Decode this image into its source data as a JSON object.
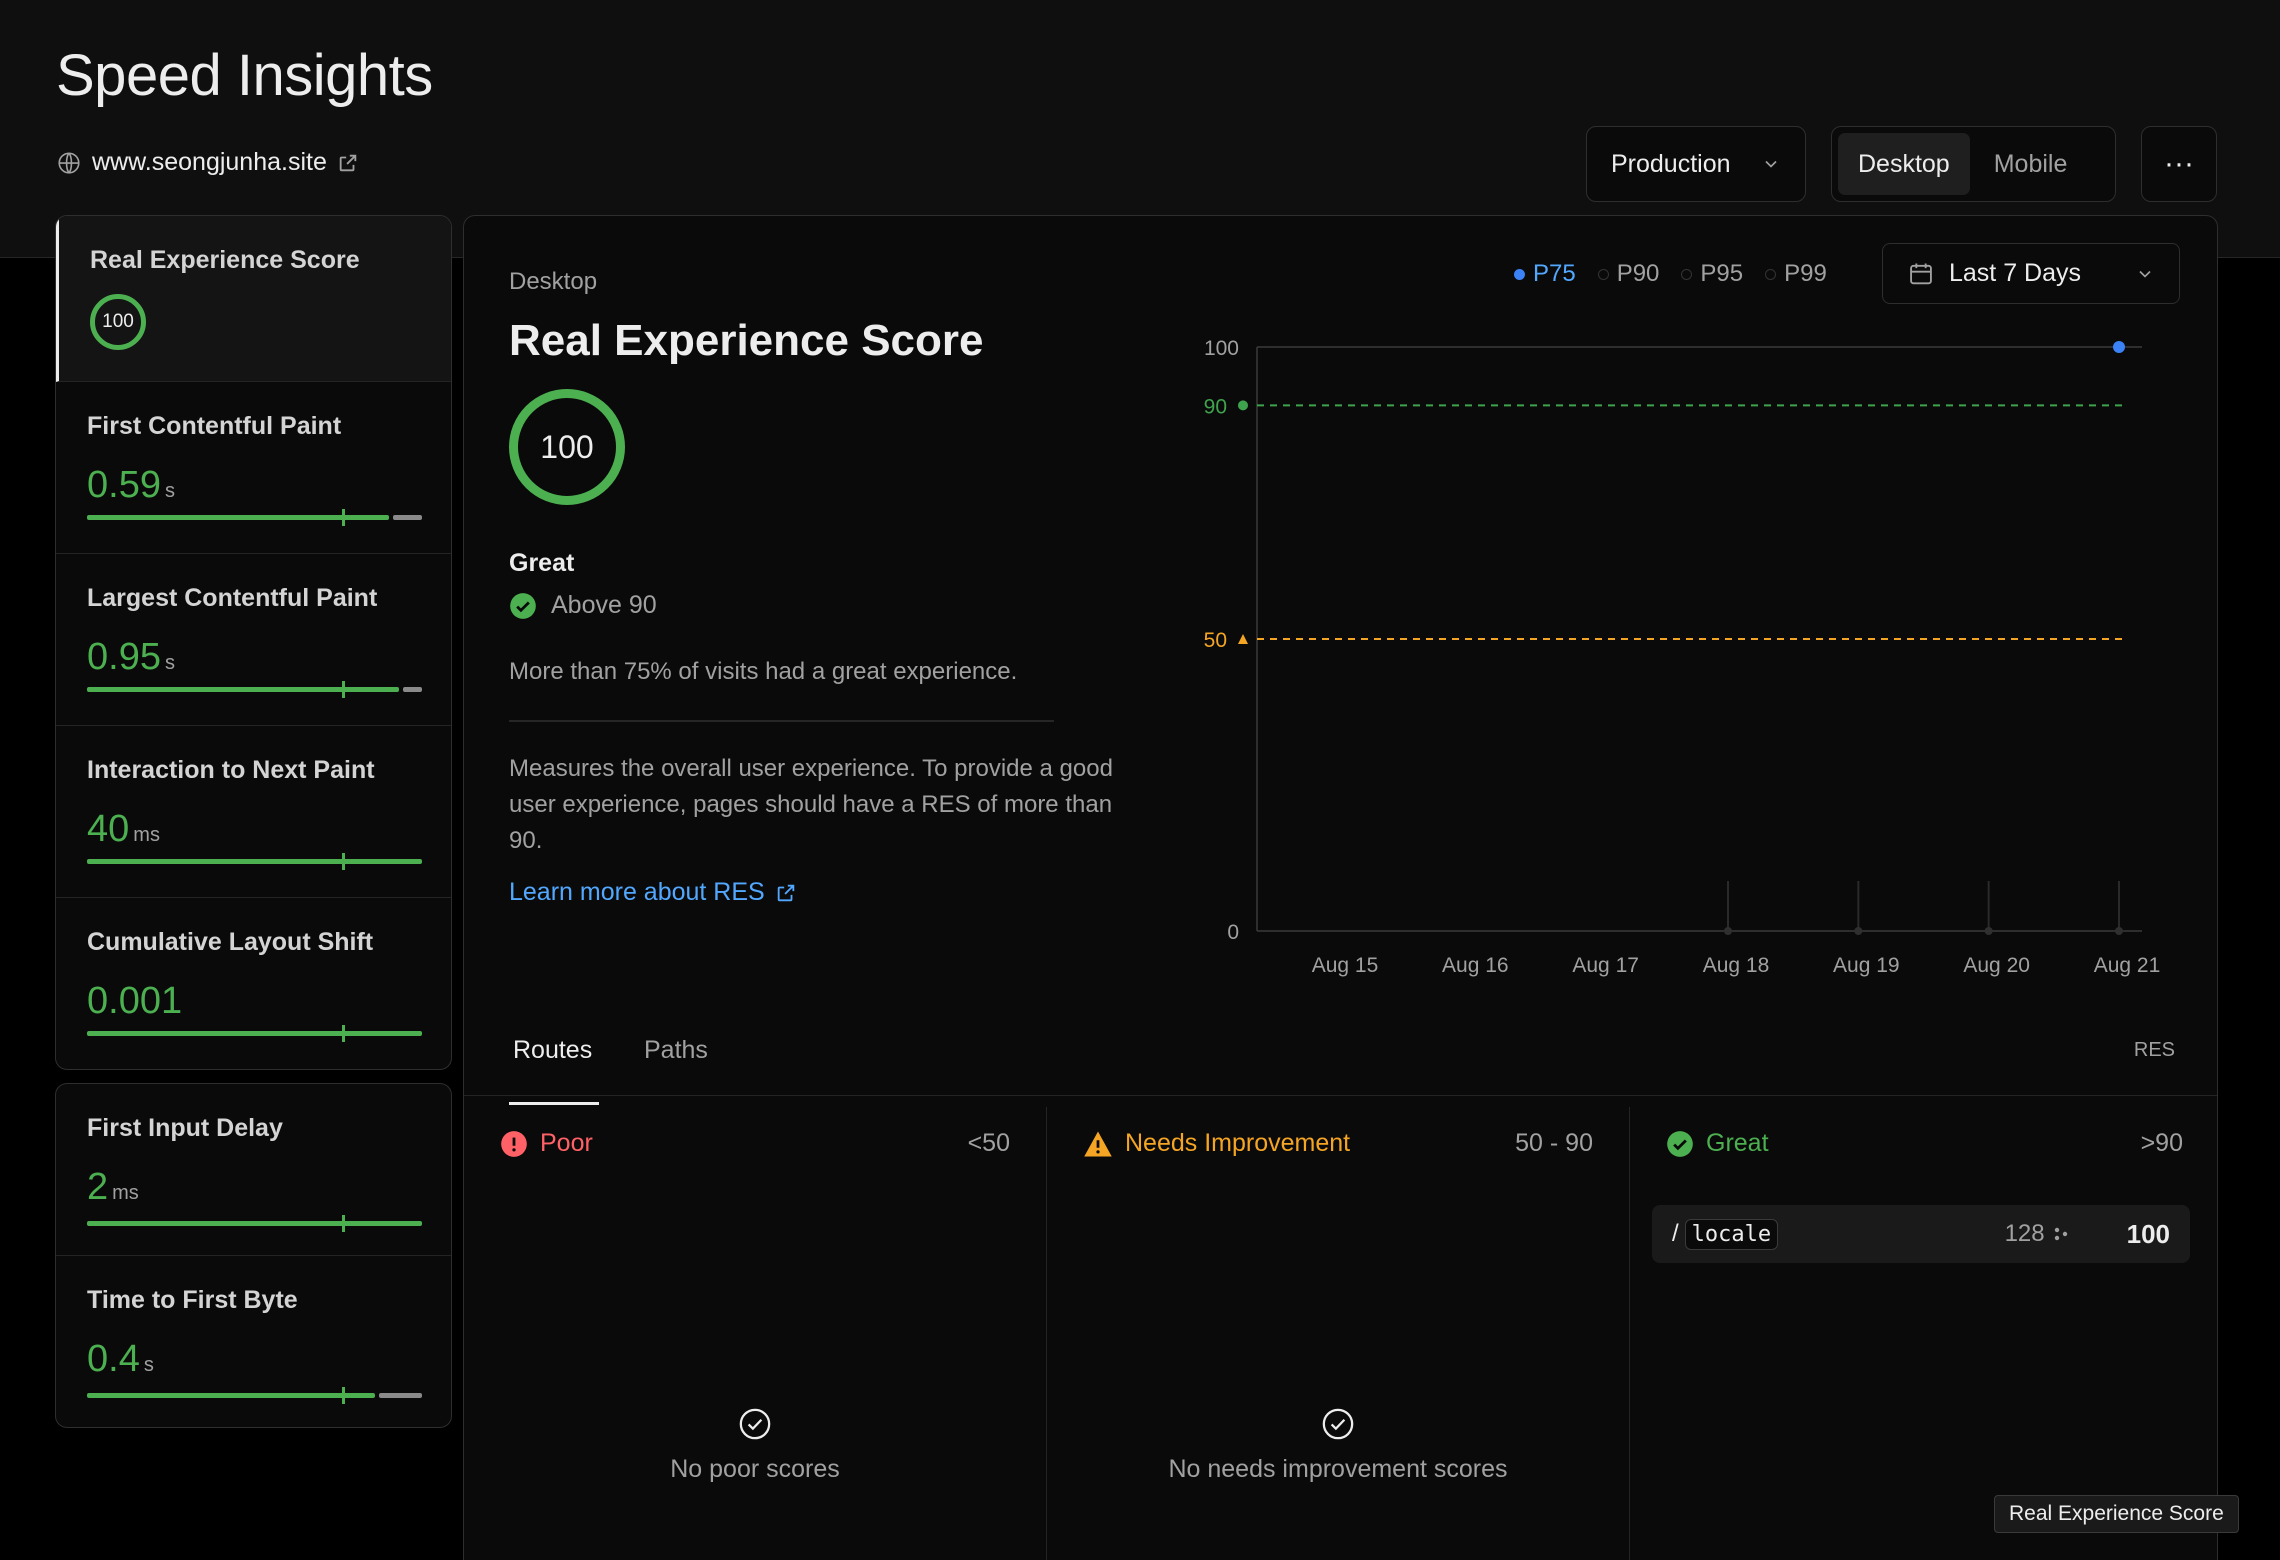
{
  "page_title": "Speed Insights",
  "site": {
    "domain": "www.seongjunha.site"
  },
  "environment": {
    "selected": "Production"
  },
  "device_toggle": {
    "options": [
      "Desktop",
      "Mobile"
    ],
    "selected": "Desktop"
  },
  "more_label": "···",
  "sidebar": {
    "primary": [
      {
        "name": "Real Experience Score",
        "score": "100"
      },
      {
        "name": "First Contentful Paint",
        "value": "0.59",
        "unit": "s",
        "good_fraction": 0.9,
        "marker_fraction": 0.76
      },
      {
        "name": "Largest Contentful Paint",
        "value": "0.95",
        "unit": "s",
        "good_fraction": 0.93,
        "marker_fraction": 0.76
      },
      {
        "name": "Interaction to Next Paint",
        "value": "40",
        "unit": "ms",
        "good_fraction": 1.0,
        "marker_fraction": 0.76
      },
      {
        "name": "Cumulative Layout Shift",
        "value": "0.001",
        "unit": "",
        "good_fraction": 1.0,
        "marker_fraction": 0.76
      }
    ],
    "secondary": [
      {
        "name": "First Input Delay",
        "value": "2",
        "unit": "ms",
        "good_fraction": 1.0,
        "marker_fraction": 0.76
      },
      {
        "name": "Time to First Byte",
        "value": "0.4",
        "unit": "s",
        "good_fraction": 0.86,
        "marker_fraction": 0.76
      }
    ]
  },
  "detail": {
    "device": "Desktop",
    "title": "Real Experience Score",
    "score": "100",
    "rating": "Great",
    "threshold_text": "Above 90",
    "summary": "More than 75% of visits had a great experience.",
    "description": "Measures the overall user experience. To provide a good user experience, pages should have a RES of more than 90.",
    "learn_more": "Learn more about RES"
  },
  "percentiles": {
    "options": [
      "P75",
      "P90",
      "P95",
      "P99"
    ],
    "selected": "P75"
  },
  "date_range": {
    "selected": "Last 7 Days"
  },
  "chart_data": {
    "type": "line",
    "x": [
      "Aug 15",
      "Aug 16",
      "Aug 17",
      "Aug 18",
      "Aug 19",
      "Aug 20",
      "Aug 21"
    ],
    "series": [
      {
        "values": [
          null,
          null,
          null,
          null,
          null,
          null,
          100
        ]
      }
    ],
    "ylim": [
      0,
      100
    ],
    "yticks": [
      "0",
      "50",
      "90",
      "100"
    ],
    "thresholds": [
      {
        "value": 90,
        "label": "90",
        "color": "#3fa34d"
      },
      {
        "value": 50,
        "label": "50",
        "color": "#f5a524"
      }
    ],
    "grid": false
  },
  "tabs": {
    "items": [
      "Routes",
      "Paths"
    ],
    "selected": "Routes",
    "right_label": "RES"
  },
  "buckets": [
    {
      "label": "Poor",
      "range": "<50",
      "empty_text": "No poor scores",
      "color": "#ff6166"
    },
    {
      "label": "Needs Improvement",
      "range": "50 - 90",
      "empty_text": "No needs improvement scores",
      "color": "#f5a524"
    },
    {
      "label": "Great",
      "range": ">90",
      "color": "#4caf50"
    }
  ],
  "routes": [
    {
      "slash": "/",
      "segment": "locale",
      "visits": "128",
      "score": "100"
    }
  ],
  "tooltip": "Real Experience Score"
}
